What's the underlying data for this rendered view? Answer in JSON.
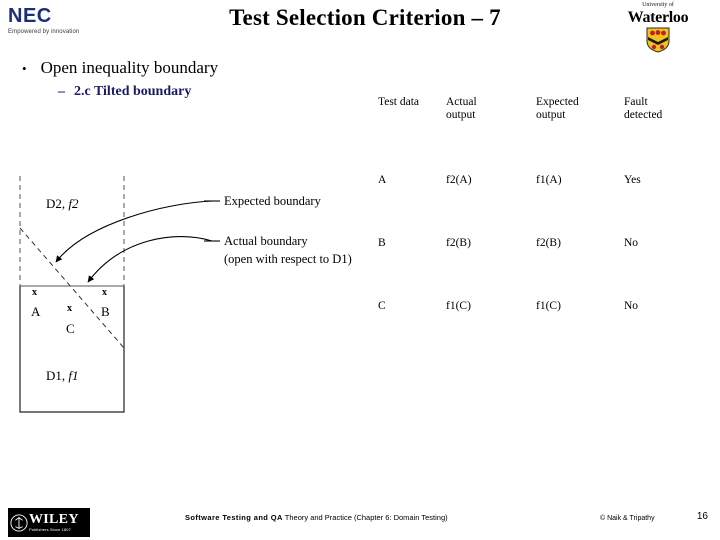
{
  "branding": {
    "nec": {
      "wordmark": "NEC",
      "tagline": "Empowered by innovation"
    },
    "waterloo": {
      "line1": "University of",
      "line2": "Waterloo",
      "shield_colors": {
        "field": "#f2c41a",
        "charge": "#c0202a",
        "chevron": "#111111"
      }
    },
    "wiley": {
      "wordmark": "WILEY",
      "tagline": "Publishers Since 1807"
    }
  },
  "header": {
    "title": "Test Selection Criterion – 7"
  },
  "bullets": {
    "level1": {
      "marker": "•",
      "text": "Open inequality boundary"
    },
    "level2": {
      "marker": "–",
      "text": "2.c Tilted boundary",
      "color": "#1a1a63"
    }
  },
  "table": {
    "headers": [
      "Test data",
      "Actual\noutput",
      "Expected\noutput",
      "Fault\ndetected"
    ],
    "headers_line1": [
      "Test data",
      "Actual",
      "Expected",
      "Fault"
    ],
    "headers_line2": [
      "",
      "output",
      "output",
      "detected"
    ],
    "rows": [
      {
        "test_data": "A",
        "actual_output": "f2(A)",
        "expected_output": "f1(A)",
        "fault_detected": "Yes"
      },
      {
        "test_data": "B",
        "actual_output": "f2(B)",
        "expected_output": "f2(B)",
        "fault_detected": "No"
      },
      {
        "test_data": "C",
        "actual_output": "f1(C)",
        "expected_output": "f1(C)",
        "fault_detected": "No"
      }
    ]
  },
  "diagram": {
    "region_upper_label": "D2, f2",
    "region_lower_label": "D1, f1",
    "point_a": "A",
    "point_b": "B",
    "point_c": "C",
    "x_mark": "x",
    "annotation_expected": "Expected boundary",
    "annotation_actual_line1": "Actual boundary",
    "annotation_actual_line2": "(open with respect to D1)"
  },
  "footer": {
    "center_strong": "Software Testing and QA",
    "center_rest": " Theory and Practice (Chapter 6: Domain Testing)",
    "copyright": "© Naik & Tripathy",
    "page_number": "16"
  }
}
